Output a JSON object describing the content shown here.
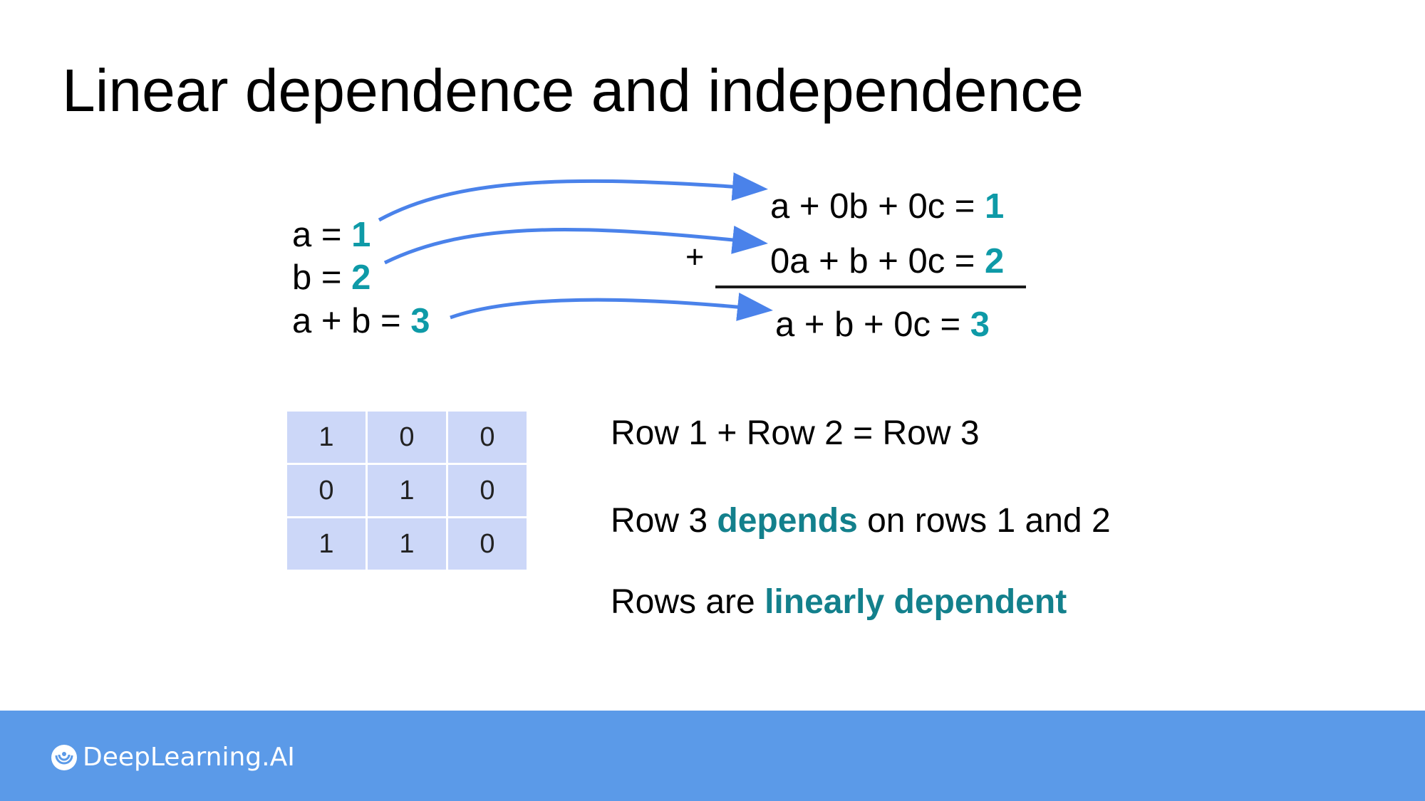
{
  "title": "Linear dependence and independence",
  "system": [
    {
      "lhs": "a = ",
      "value": "1"
    },
    {
      "lhs": "b = ",
      "value": "2"
    },
    {
      "lhs": "a + b = ",
      "value": "3"
    }
  ],
  "expanded": [
    {
      "lhs": "a + 0b + 0c = ",
      "value": "1"
    },
    {
      "lhs": "0a + b + 0c = ",
      "value": "2"
    },
    {
      "lhs": "a + b + 0c = ",
      "value": "3"
    }
  ],
  "plus_sign": "+",
  "matrix": [
    [
      "1",
      "0",
      "0"
    ],
    [
      "0",
      "1",
      "0"
    ],
    [
      "1",
      "1",
      "0"
    ]
  ],
  "statements": {
    "row_sum": "Row 1 + Row 2 = Row 3",
    "depends": {
      "before": "Row 3 ",
      "highlight": "depends",
      "after": " on rows 1 and 2"
    },
    "conclusion": {
      "before": "Rows are ",
      "highlight": "linearly dependent"
    }
  },
  "footer": {
    "brand": "DeepLearning.AI"
  },
  "colors": {
    "value_teal": "#0e9aa7",
    "highlight_teal": "#13808c",
    "arrow_blue": "#4a82ea",
    "matrix_cell": "#ccd7f8",
    "footer_bar": "#5b9ae8"
  },
  "icons": {
    "arrow": "arrow-right-curved-icon",
    "brand": "deeplearning-logo-icon"
  }
}
